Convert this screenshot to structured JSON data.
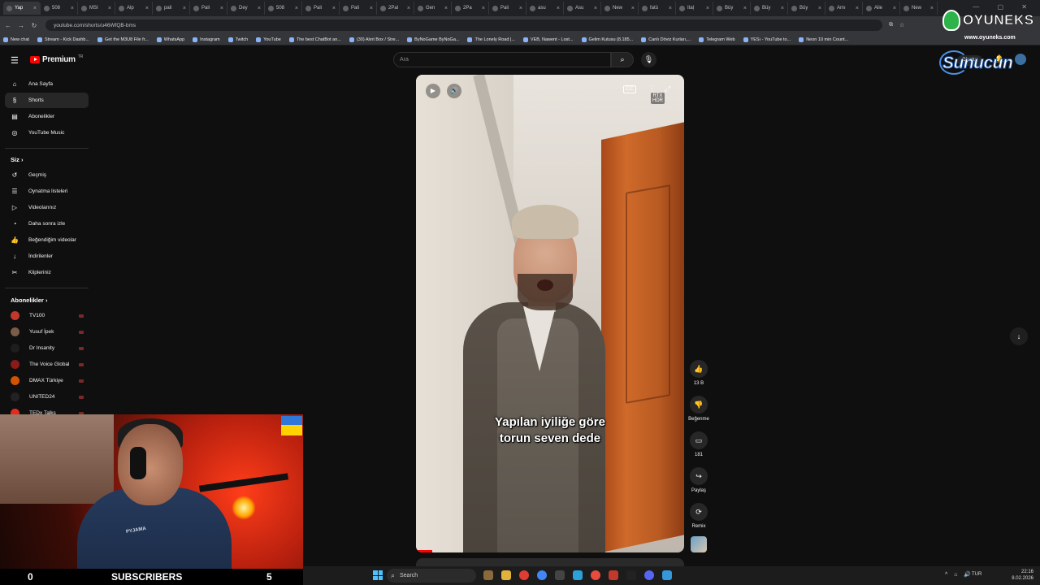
{
  "browser": {
    "tabs": [
      {
        "label": "Yap",
        "active": true
      },
      {
        "label": "508"
      },
      {
        "label": "MSI"
      },
      {
        "label": "Alp"
      },
      {
        "label": "pali"
      },
      {
        "label": "Pali"
      },
      {
        "label": "Dey"
      },
      {
        "label": "508"
      },
      {
        "label": "Pali"
      },
      {
        "label": "Pali"
      },
      {
        "label": "2Pal"
      },
      {
        "label": "Gen"
      },
      {
        "label": "2Pa"
      },
      {
        "label": "Pali"
      },
      {
        "label": "asu"
      },
      {
        "label": "Asu"
      },
      {
        "label": "New"
      },
      {
        "label": "fatü"
      },
      {
        "label": "Itaļ"
      },
      {
        "label": "Büy"
      },
      {
        "label": "Büy"
      },
      {
        "label": "Büy"
      },
      {
        "label": "Amı"
      },
      {
        "label": "Alie"
      },
      {
        "label": "New"
      }
    ],
    "url": "youtube.com/shorts/u46WfQB-bms",
    "bookmarks": [
      "New chat",
      "Stream - Kick Dashb...",
      "Get the M3U8 File fr...",
      "WhatsApp",
      "Instagram",
      "Twitch",
      "YouTube",
      "The best ChatBot an...",
      "(30) Alınt Box / Stre...",
      "ByNoGame ByNoGa...",
      "The Lonely Road |...",
      "VEB, Nawent - Lost...",
      "Gelim Kutusu (8.185...",
      "Canlı Döviz Kurları,...",
      "Telegram Web",
      "YESı - YouTube to...",
      "Neon 10 min Count..."
    ]
  },
  "youtube": {
    "logo_text": "Premium",
    "logo_sup": "TR",
    "search_placeholder": "Ara",
    "create_label": "Oluştur",
    "nav": [
      {
        "label": "Ana Sayfa",
        "icon": "home-icon",
        "glyph": "⌂"
      },
      {
        "label": "Shorts",
        "icon": "shorts-icon",
        "glyph": "§",
        "active": true
      },
      {
        "label": "Abonelikler",
        "icon": "subscriptions-icon",
        "glyph": "▤"
      },
      {
        "label": "YouTube Music",
        "icon": "music-icon",
        "glyph": "◎"
      }
    ],
    "you_section_title": "Siz",
    "you_items": [
      {
        "label": "Geçmiş",
        "icon": "history-icon",
        "glyph": "↺"
      },
      {
        "label": "Oynatma listeleri",
        "icon": "playlists-icon",
        "glyph": "☰"
      },
      {
        "label": "Videolarınız",
        "icon": "your-videos-icon",
        "glyph": "▷"
      },
      {
        "label": "Daha sonra izle",
        "icon": "watch-later-icon",
        "glyph": "◔"
      },
      {
        "label": "Beğendiğim videolar",
        "icon": "liked-icon",
        "glyph": "👍"
      },
      {
        "label": "İndirilenler",
        "icon": "downloads-icon",
        "glyph": "↓"
      },
      {
        "label": "Klipleriniz",
        "icon": "clips-icon",
        "glyph": "✂"
      }
    ],
    "subs_section_title": "Abonelikler",
    "subscriptions": [
      {
        "label": "TV100",
        "color": "#c0392b"
      },
      {
        "label": "Yusuf İpek",
        "color": "#7a5c48"
      },
      {
        "label": "Dr Insanity",
        "color": "#1e1e1e"
      },
      {
        "label": "The Voice Global",
        "color": "#8b1a1a"
      },
      {
        "label": "DMAX Türkiye",
        "color": "#d35400"
      },
      {
        "label": "UNITED24",
        "color": "#222222"
      },
      {
        "label": "TEDx Talks",
        "color": "#e62b1e"
      }
    ]
  },
  "short": {
    "caption_line1": "Yapılan iyiliğe göre",
    "caption_line2": "torun seven dede",
    "hdr_badge_line1": "RTX",
    "hdr_badge_line2": "HDR",
    "likes": "13 B",
    "dislike_label": "Beğenme",
    "comments": "181",
    "share_label": "Paylaş",
    "remix_label": "Remix",
    "progress": 0.06
  },
  "webcam_overlay": {
    "left_count": "0",
    "label": "SUBSCRIBERS",
    "right_count": "5",
    "hoodie_text": "PYJAMA"
  },
  "taskbar": {
    "search_label": "Search",
    "lang": "TUR",
    "time": "22:16",
    "date": "8.02.2026"
  },
  "watermark": {
    "brand": "OYUNEKS",
    "url": "www.oyuneks.com",
    "brand2": "Sunucun"
  }
}
